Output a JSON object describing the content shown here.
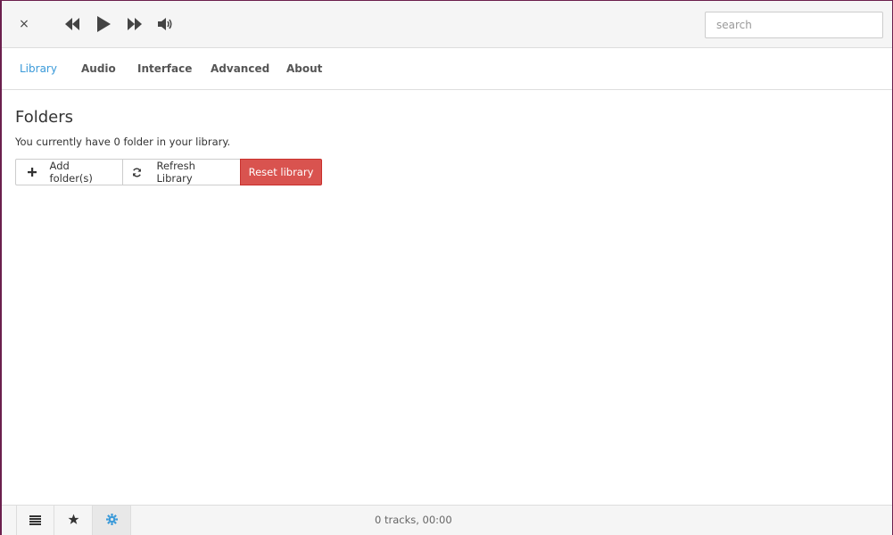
{
  "header": {
    "controls": [
      {
        "name": "close-icon",
        "glyph": "×"
      },
      {
        "name": "previous-icon"
      },
      {
        "name": "play-icon"
      },
      {
        "name": "next-icon"
      },
      {
        "name": "volume-icon"
      }
    ],
    "search": {
      "placeholder": "search",
      "value": ""
    }
  },
  "tabs": [
    {
      "label": "Library",
      "active": true
    },
    {
      "label": "Audio",
      "active": false
    },
    {
      "label": "Interface",
      "active": false
    },
    {
      "label": "Advanced",
      "active": false
    },
    {
      "label": "About",
      "active": false
    }
  ],
  "library": {
    "title": "Folders",
    "description": "You currently have 0 folder in your library.",
    "buttons": {
      "add": "Add folder(s)",
      "refresh": "Refresh Library",
      "reset": "Reset library"
    }
  },
  "footer": {
    "tabs": [
      {
        "icon": "list-icon",
        "active": false
      },
      {
        "icon": "star-icon",
        "active": false
      },
      {
        "icon": "gear-icon",
        "active": true
      }
    ],
    "status": "0 tracks, 00:00"
  },
  "colors": {
    "accent": "#3a9ad9",
    "danger": "#d9534f",
    "window_border": "#6b1f4d"
  }
}
